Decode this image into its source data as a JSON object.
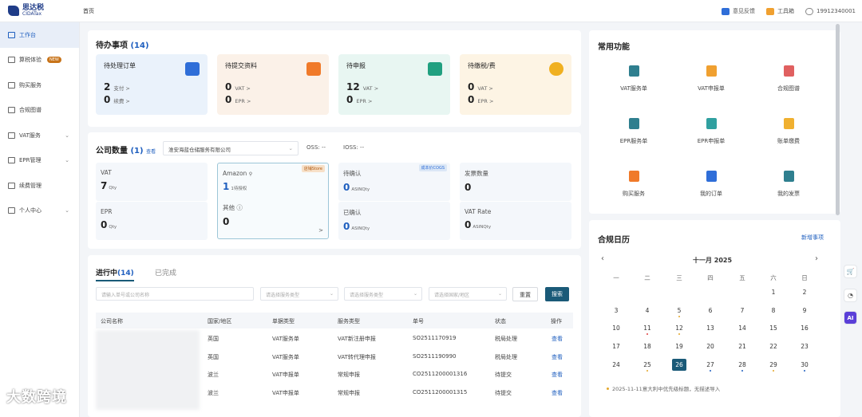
{
  "topbar": {
    "logo_cn": "思达税",
    "logo_en": "CIDATax",
    "breadcrumb": "首页",
    "feedback": "意见反馈",
    "toolbox": "工具箱",
    "phone": "19912340001"
  },
  "sidebar": {
    "items": [
      {
        "label": "工作台"
      },
      {
        "label": "算税体验",
        "badge": "NEW"
      },
      {
        "label": "购买服务"
      },
      {
        "label": "合规图谱"
      },
      {
        "label": "VAT服务",
        "chevron": "⌄"
      },
      {
        "label": "EPR管理",
        "chevron": "⌄"
      },
      {
        "label": "续费管理"
      },
      {
        "label": "个人中心",
        "chevron": "⌄"
      }
    ]
  },
  "todo": {
    "title": "待办事项",
    "count": "(14)",
    "cards": [
      {
        "title": "待处理订单",
        "rows": [
          {
            "n": "2",
            "l": "支付 >"
          },
          {
            "n": "0",
            "l": "续费 >"
          }
        ],
        "color": "#2f6ed8",
        "bg": "#eaf2fb"
      },
      {
        "title": "待提交资料",
        "rows": [
          {
            "n": "0",
            "l": "VAT >"
          },
          {
            "n": "0",
            "l": "EPR >"
          }
        ],
        "color": "#f07a2a",
        "bg": "#fbf1e8"
      },
      {
        "title": "待申报",
        "rows": [
          {
            "n": "12",
            "l": "VAT >"
          },
          {
            "n": "0",
            "l": "EPR >"
          }
        ],
        "color": "#20a080",
        "bg": "#e8f6f2"
      },
      {
        "title": "待缴税/费",
        "rows": [
          {
            "n": "0",
            "l": "VAT >"
          },
          {
            "n": "0",
            "l": "EPR >"
          }
        ],
        "color": "#f0b020",
        "bg": "#fdf4e4"
      }
    ]
  },
  "company": {
    "title": "公司数量",
    "count": "(1)",
    "view": "查看",
    "select": "淮安海蓝仓储服务有限公司",
    "oss": "OSS: --",
    "ioss": "IOSS: --"
  },
  "grid": [
    {
      "k": "VAT",
      "v": "7",
      "u": "Qty"
    },
    {
      "k": "Amazon",
      "v": "1",
      "u": "1待授权",
      "tag": "店铺Store"
    },
    {
      "k": "待确认",
      "v": "0",
      "u": "ASINQty",
      "tag": "成本价COGS"
    },
    {
      "k": "发票数量",
      "v": "0",
      "u": ""
    },
    {
      "k": "EPR",
      "v": "0",
      "u": "Qty"
    },
    {
      "k": "其他 ⓘ",
      "v": "0",
      "u": "",
      "arrow": ">"
    },
    {
      "k": "已确认",
      "v": "0",
      "u": "ASINQty"
    },
    {
      "k": "VAT Rate",
      "v": "0",
      "u": "ASINQty"
    }
  ],
  "progress": {
    "tab_active": "进行中",
    "tab_count": "(14)",
    "tab_done": "已完成",
    "search_ph": "请输入单号或公司名称",
    "f1": "请选择服务类型",
    "f2": "请选择服务类型",
    "f3": "请选择国家/地区",
    "reset": "重置",
    "search": "搜索",
    "headers": [
      "公司名称",
      "国家/地区",
      "单据类型",
      "服务类型",
      "单号",
      "状态",
      "操作"
    ],
    "rows": [
      {
        "country": "英国",
        "doc": "VAT服务单",
        "svc": "VAT新注册申报",
        "no": "SO2511170919",
        "status": "税局处理",
        "op": "查看"
      },
      {
        "country": "英国",
        "doc": "VAT服务单",
        "svc": "VAT转代理申报",
        "no": "SO2511190990",
        "status": "税局处理",
        "op": "查看"
      },
      {
        "country": "波兰",
        "doc": "VAT申报单",
        "svc": "常规申报",
        "no": "CO2511200001316",
        "status": "待提交",
        "op": "查看"
      },
      {
        "country": "波兰",
        "doc": "VAT申报单",
        "svc": "常规申报",
        "no": "CO2511200001315",
        "status": "待提交",
        "op": "查看"
      }
    ]
  },
  "functions": {
    "title": "常用功能",
    "items": [
      {
        "label": "VAT服务单",
        "color": "#2f7f8f"
      },
      {
        "label": "VAT申报单",
        "color": "#f0a030"
      },
      {
        "label": "合规图谱",
        "color": "#e06060"
      },
      {
        "label": "EPR服务单",
        "color": "#2f7f8f"
      },
      {
        "label": "EPR申报单",
        "color": "#30a0a0"
      },
      {
        "label": "账单缴费",
        "color": "#f0b030"
      },
      {
        "label": "购买服务",
        "color": "#f07a2a"
      },
      {
        "label": "我的订单",
        "color": "#2f6ed8"
      },
      {
        "label": "我的发票",
        "color": "#2f7f8f"
      }
    ]
  },
  "calendar": {
    "title": "合规日历",
    "add": "新增事项",
    "month": "十一月 2025",
    "weekdays": [
      "一",
      "二",
      "三",
      "四",
      "五",
      "六",
      "日"
    ],
    "weeks": [
      [
        "",
        "",
        "",
        "",
        "",
        "1",
        "2"
      ],
      [
        "3",
        "4",
        "5",
        "6",
        "7",
        "8",
        "9"
      ],
      [
        "10",
        "11",
        "12",
        "13",
        "14",
        "15",
        "16"
      ],
      [
        "17",
        "18",
        "19",
        "20",
        "21",
        "22",
        "23"
      ],
      [
        "24",
        "25",
        "26",
        "27",
        "28",
        "29",
        "30"
      ]
    ],
    "note": "2025-11-11意大利中优先级标题，无描述导入",
    "selected": "26"
  },
  "watermark": "大数跨境"
}
